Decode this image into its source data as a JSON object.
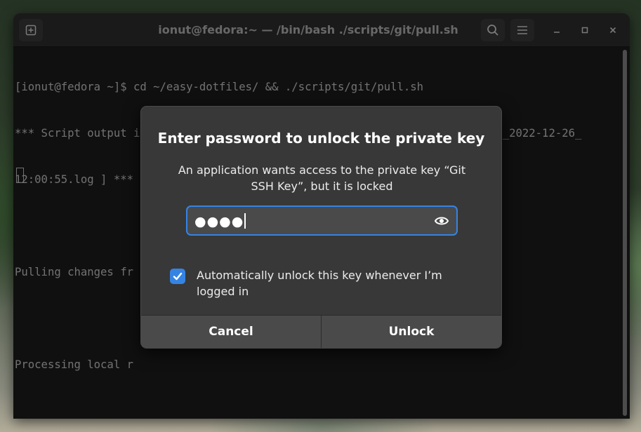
{
  "window": {
    "title": "ionut@fedora:~ — /bin/bash ./scripts/git/pull.sh",
    "icons": {
      "new_tab": "new-tab-icon",
      "search": "search-icon",
      "menu": "hamburger-menu-icon",
      "minimize": "minimize-icon",
      "maximize": "maximize-icon",
      "close": "close-icon"
    }
  },
  "terminal": {
    "lines": [
      "[ionut@fedora ~]$ cd ~/easy-dotfiles/ && ./scripts/git/pull.sh",
      "*** Script output is saved to [ /home/ionut/easy-dotfiles/logs/manual-pull_2022-12-26_",
      "12:00:55.log ] ***",
      "",
      "Pulling changes fr",
      "",
      "Processing local r"
    ]
  },
  "dialog": {
    "title": "Enter password to unlock the private key",
    "message": "An application wants access to the private key “Git SSH Key”, but it is locked",
    "password_value": "●●●●",
    "auto_unlock_checked": true,
    "auto_unlock_label": "Automatically unlock this key whenever I’m logged in",
    "cancel_label": "Cancel",
    "unlock_label": "Unlock"
  },
  "colors": {
    "accent": "#3584e4",
    "dialog_bg": "#383838",
    "terminal_bg": "#1e1e1e"
  }
}
